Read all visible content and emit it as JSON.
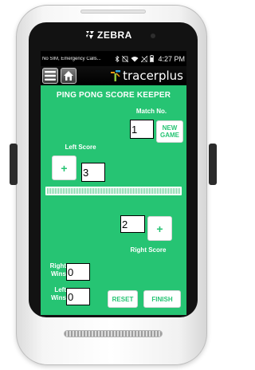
{
  "device": {
    "brand": "ZEBRA"
  },
  "status_bar": {
    "carrier_text": "No SIM, Emergency Calls...",
    "time": "4:27 PM"
  },
  "app_bar": {
    "menu_icon": "hamburger-menu-icon",
    "home_icon": "home-icon",
    "brand": "tracerplus",
    "brand_colors": [
      "#f39c12",
      "#2fa3d8",
      "#8cc63f"
    ]
  },
  "app": {
    "title": "PING PONG SCORE KEEPER",
    "match_label": "Match No.",
    "match_value": "1",
    "new_game_label": "NEW GAME",
    "left_score_label": "Left Score",
    "left_plus_label": "+",
    "left_score_value": "3",
    "right_score_label": "Right Score",
    "right_plus_label": "+",
    "right_score_value": "2",
    "right_wins_label": "Right Wins",
    "right_wins_value": "0",
    "left_wins_label": "Left Wins",
    "left_wins_value": "0",
    "reset_label": "RESET",
    "finish_label": "FINISH"
  },
  "colors": {
    "accent": "#26c473",
    "text_on_accent": "#ffffff",
    "app_bar": "#000000"
  }
}
